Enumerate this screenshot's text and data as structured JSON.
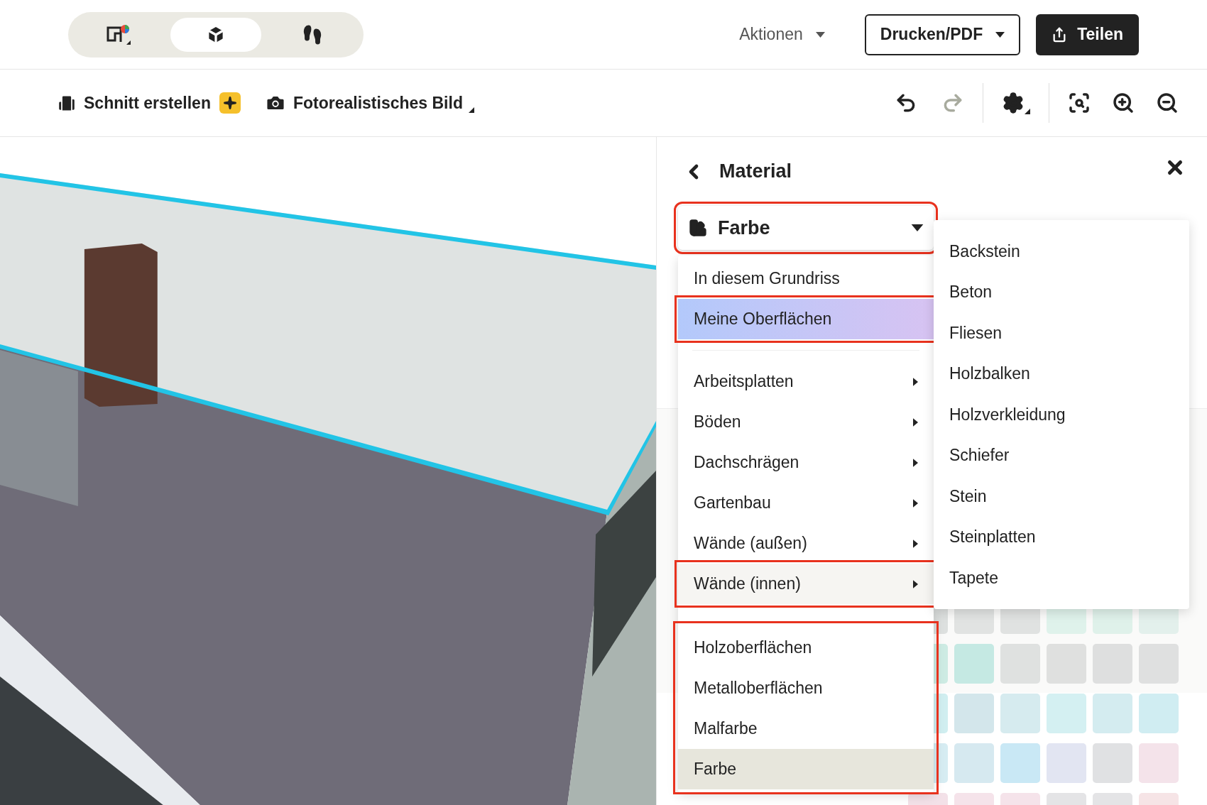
{
  "view_modes": [
    {
      "kind": "plan",
      "selected": false
    },
    {
      "kind": "model",
      "selected": true
    },
    {
      "kind": "walk",
      "selected": false
    }
  ],
  "actions": {
    "menu": "Aktionen",
    "print": "Drucken/PDF",
    "share": "Teilen"
  },
  "toolbar": {
    "section": "Schnitt erstellen",
    "photo": "Fotorealistisches Bild",
    "undo_disabled": false,
    "redo_disabled": true
  },
  "panel": {
    "title": "Material",
    "dropdown": {
      "value": "Farbe",
      "highlighted": true
    },
    "menu": [
      {
        "items": [
          {
            "label": "In diesem Grundriss",
            "has_submenu": false,
            "selected": false,
            "featured": false,
            "expanded": false,
            "highlighted": false
          },
          {
            "label": "Meine Oberflächen",
            "has_submenu": false,
            "selected": false,
            "featured": true,
            "expanded": false,
            "highlighted": true
          }
        ]
      },
      {
        "items": [
          {
            "label": "Arbeitsplatten",
            "has_submenu": true,
            "selected": false,
            "featured": false,
            "expanded": false,
            "highlighted": false
          },
          {
            "label": "Böden",
            "has_submenu": true,
            "selected": false,
            "featured": false,
            "expanded": false,
            "highlighted": false
          },
          {
            "label": "Dachschrägen",
            "has_submenu": true,
            "selected": false,
            "featured": false,
            "expanded": false,
            "highlighted": false
          },
          {
            "label": "Gartenbau",
            "has_submenu": true,
            "selected": false,
            "featured": false,
            "expanded": false,
            "highlighted": false
          },
          {
            "label": "Wände (außen)",
            "has_submenu": true,
            "selected": false,
            "featured": false,
            "expanded": false,
            "highlighted": false
          },
          {
            "label": "Wände (innen)",
            "has_submenu": true,
            "selected": false,
            "featured": false,
            "expanded": true,
            "highlighted": true
          }
        ]
      },
      {
        "highlighted": true,
        "items": [
          {
            "label": "Holzoberflächen",
            "has_submenu": false,
            "selected": false,
            "featured": false,
            "expanded": false
          },
          {
            "label": "Metalloberflächen",
            "has_submenu": false,
            "selected": false,
            "featured": false,
            "expanded": false
          },
          {
            "label": "Malfarbe",
            "has_submenu": false,
            "selected": false,
            "featured": false,
            "expanded": false
          },
          {
            "label": "Farbe",
            "has_submenu": false,
            "selected": true,
            "featured": false,
            "expanded": false
          }
        ]
      }
    ],
    "submenu": [
      {
        "label": "Backstein"
      },
      {
        "label": "Beton"
      },
      {
        "label": "Fliesen"
      },
      {
        "label": "Holzbalken"
      },
      {
        "label": "Holzverkleidung"
      },
      {
        "label": "Schiefer"
      },
      {
        "label": "Stein"
      },
      {
        "label": "Steinplatten"
      },
      {
        "label": "Tapete"
      }
    ],
    "swatches": [
      {
        "color": "#dde0df"
      },
      {
        "color": "#e1e3e2"
      },
      {
        "color": "#e0e2e1"
      },
      {
        "color": "#dff2eb"
      },
      {
        "color": "#dff1ea"
      },
      {
        "color": "#e3f0ec"
      },
      {
        "color": "#cdebe3"
      },
      {
        "color": "#c5e9e3"
      },
      {
        "color": "#dfe1e0"
      },
      {
        "color": "#dfe0df"
      },
      {
        "color": "#dedfdf"
      },
      {
        "color": "#dfe0e0"
      },
      {
        "color": "#d0eef0"
      },
      {
        "color": "#d3e6eb"
      },
      {
        "color": "#d6ebef"
      },
      {
        "color": "#d4f0f2"
      },
      {
        "color": "#d4ecf0"
      },
      {
        "color": "#d0edf2"
      },
      {
        "color": "#d6ecf2"
      },
      {
        "color": "#d6e9f0"
      },
      {
        "color": "#c9e8f5"
      },
      {
        "color": "#e2e5f2"
      },
      {
        "color": "#e0e1e3"
      },
      {
        "color": "#f4e3ea"
      },
      {
        "color": "#f3e1e8"
      },
      {
        "color": "#f5e3ea"
      },
      {
        "color": "#f5e3ea"
      },
      {
        "color": "#e4e4e6"
      },
      {
        "color": "#e4e4e6"
      },
      {
        "color": "#f6e4e6"
      }
    ]
  }
}
